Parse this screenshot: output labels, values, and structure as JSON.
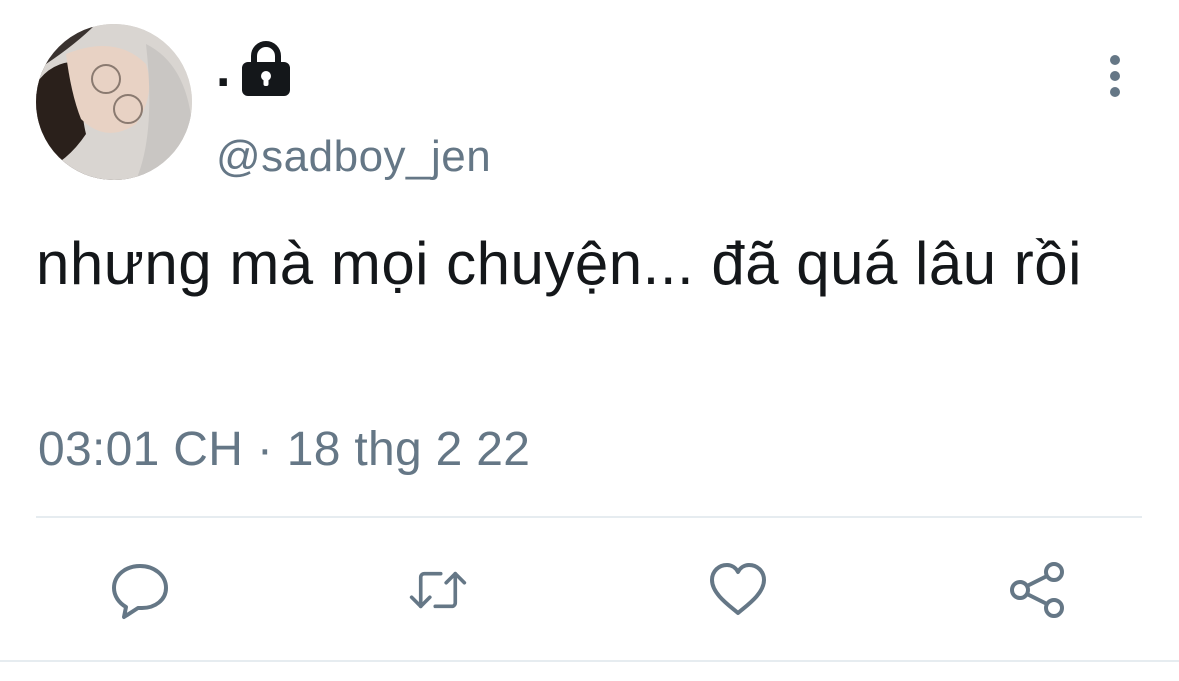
{
  "tweet": {
    "display_name": ".",
    "handle": "@sadboy_jen",
    "text": "nhưng mà mọi chuyện... đã quá lâu rồi",
    "timestamp": "03:01 CH · 18 thg 2 22",
    "protected_icon": "lock-icon",
    "menu_icon": "more-vertical-icon"
  },
  "actions": [
    {
      "name": "reply",
      "icon": "reply-icon"
    },
    {
      "name": "retweet",
      "icon": "retweet-icon"
    },
    {
      "name": "like",
      "icon": "heart-icon"
    },
    {
      "name": "share",
      "icon": "share-icon"
    }
  ],
  "colors": {
    "text_primary": "#14171a",
    "text_secondary": "#657786",
    "icon": "#657786",
    "divider": "#e6ecf0",
    "background": "#ffffff"
  }
}
